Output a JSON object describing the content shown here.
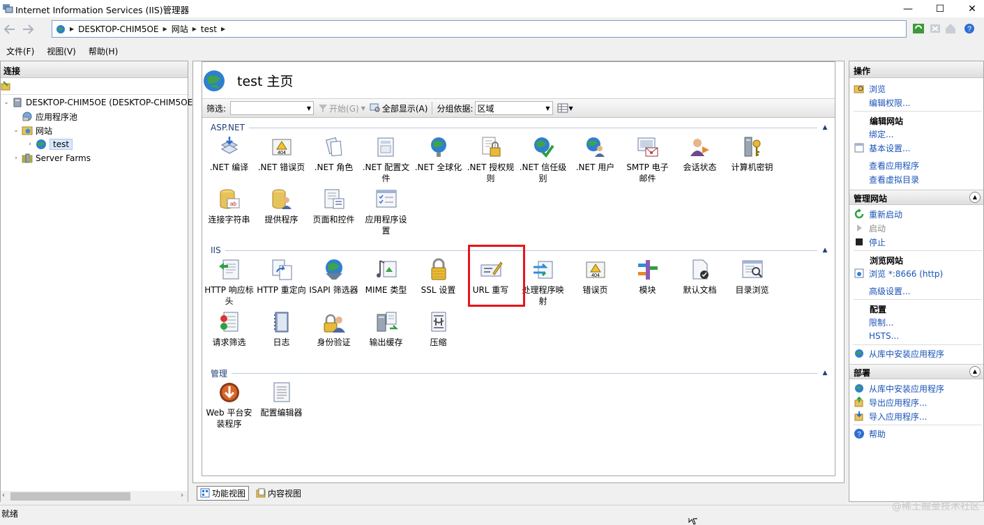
{
  "window": {
    "title": "Internet Information Services (IIS)管理器",
    "controls": {
      "minimize": "—",
      "maximize": "☐",
      "close": "✕"
    }
  },
  "address": {
    "crumbs": [
      "DESKTOP-CHIM5OE",
      "网站",
      "test"
    ]
  },
  "menu": [
    "文件(F)",
    "视图(V)",
    "帮助(H)"
  ],
  "connections": {
    "title": "连接",
    "tree": [
      {
        "label": "DESKTOP-CHIM5OE (DESKTOP-CHIM5OE",
        "icon": "server-icon"
      },
      {
        "label": "应用程序池",
        "icon": "app-pool-icon"
      },
      {
        "label": "网站",
        "icon": "sites-folder-icon"
      },
      {
        "label": "test",
        "icon": "globe-icon"
      },
      {
        "label": "Server Farms",
        "icon": "server-farms-icon"
      }
    ]
  },
  "main": {
    "title": "test 主页",
    "filter": {
      "label": "筛选:",
      "value": "",
      "start": "开始(G)",
      "show_all": "全部显示(A)",
      "group_by_label": "分组依据:",
      "group_by_value": "区域"
    },
    "groups": [
      {
        "name": "ASP.NET",
        "items": [
          [
            ".NET 编译",
            ""
          ],
          [
            ".NET 错误页",
            ""
          ],
          [
            ".NET 角色",
            ""
          ],
          [
            ".NET 配置文",
            "件"
          ],
          [
            ".NET 全球化",
            ""
          ],
          [
            ".NET 授权规",
            "则"
          ],
          [
            ".NET 信任级",
            "别"
          ],
          [
            ".NET 用户",
            ""
          ],
          [
            "SMTP 电子",
            "邮件"
          ],
          [
            "会话状态",
            ""
          ],
          [
            "计算机密钥",
            ""
          ],
          [
            "连接字符串",
            ""
          ],
          [
            "提供程序",
            ""
          ],
          [
            "页面和控件",
            ""
          ],
          [
            "应用程序设",
            "置"
          ]
        ]
      },
      {
        "name": "IIS",
        "items": [
          [
            "HTTP 响应标",
            "头"
          ],
          [
            "HTTP 重定向",
            ""
          ],
          [
            "ISAPI 筛选器",
            ""
          ],
          [
            "MIME 类型",
            ""
          ],
          [
            "SSL 设置",
            ""
          ],
          [
            "URL 重写",
            ""
          ],
          [
            "处理程序映",
            "射"
          ],
          [
            "错误页",
            ""
          ],
          [
            "模块",
            ""
          ],
          [
            "默认文档",
            ""
          ],
          [
            "目录浏览",
            ""
          ],
          [
            "请求筛选",
            ""
          ],
          [
            "日志",
            ""
          ],
          [
            "身份验证",
            ""
          ],
          [
            "输出缓存",
            ""
          ],
          [
            "压缩",
            ""
          ]
        ]
      },
      {
        "name": "管理",
        "items": [
          [
            "Web 平台安",
            "装程序"
          ],
          [
            "配置编辑器",
            ""
          ]
        ]
      }
    ],
    "view_tabs": [
      "功能视图",
      "内容视图"
    ]
  },
  "actions": {
    "title": "操作",
    "browse": "浏览",
    "edit_permissions": "编辑权限...",
    "edit_site_heading": "编辑网站",
    "bindings": "绑定...",
    "basic_settings": "基本设置...",
    "view_applications": "查看应用程序",
    "view_virtual_dirs": "查看虚拟目录",
    "manage_site_heading": "管理网站",
    "restart": "重新启动",
    "start": "启动",
    "stop": "停止",
    "browse_site_heading": "浏览网站",
    "browse_port": "浏览 *:8666 (http)",
    "advanced_settings": "高级设置...",
    "config_heading": "配置",
    "limits": "限制...",
    "hsts": "HSTS...",
    "install_from_gallery": "从库中安装应用程序",
    "deploy_heading": "部署",
    "deploy_install": "从库中安装应用程序",
    "export_app": "导出应用程序...",
    "import_app": "导入应用程序...",
    "help": "帮助"
  },
  "status": {
    "text": "就绪"
  },
  "watermark": "@稀土掘金技术社区",
  "colors": {
    "link": "#1a53b8",
    "highlight": "#e8141b",
    "group_header": "#1e3f78"
  }
}
